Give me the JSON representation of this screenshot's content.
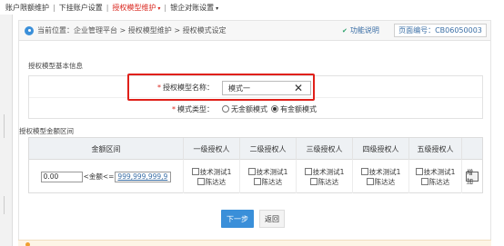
{
  "topnav": {
    "items": [
      {
        "label": "账户限额维护"
      },
      {
        "label": "下挂账户设置"
      },
      {
        "label": "授权模型维护",
        "has_caret": true,
        "active": true
      },
      {
        "label": "银企对账设置",
        "has_caret": true
      }
    ],
    "caret": "▾",
    "separator": "|"
  },
  "breadcrumb": {
    "icon": "location-icon",
    "text": "当前位置：企业管理平台 > 授权模型维护 > 授权模式设定"
  },
  "header_actions": {
    "help_label": "功能说明",
    "help_icon": "chevron-down-icon",
    "page_code": "页面编号：CB06050003"
  },
  "basic_info": {
    "title": "授权模型基本信息",
    "name_label": "授权模型名称：",
    "name_value": "模式一",
    "required_mark": "*",
    "clear_icon": "✕",
    "type_label": "模式类型：",
    "type_options": [
      {
        "label": "无金额模式",
        "checked": false
      },
      {
        "label": "有金额模式",
        "checked": true
      }
    ]
  },
  "amount_section": {
    "title": "授权模型金额区间",
    "headers": [
      "金额区间",
      "一级授权人",
      "二级授权人",
      "三级授权人",
      "四级授权人",
      "五级授权人",
      ""
    ],
    "row": {
      "min": "0.00",
      "mid": "<金额<=",
      "max": "999,999,999,9",
      "approvers": [
        [
          "技术测试1",
          "陈达达"
        ],
        [
          "技术测试1",
          "陈达达"
        ],
        [
          "技术测试1",
          "陈达达"
        ],
        [
          "技术测试1",
          "陈达达"
        ],
        [
          "技术测试1",
          "陈达达"
        ]
      ],
      "add_label": "增加"
    }
  },
  "buttons": {
    "next": "下一步",
    "back": "返回"
  },
  "colors": {
    "accent": "#3a8fd9",
    "active_nav": "#d9251d",
    "highlight_box": "#e0201a"
  }
}
